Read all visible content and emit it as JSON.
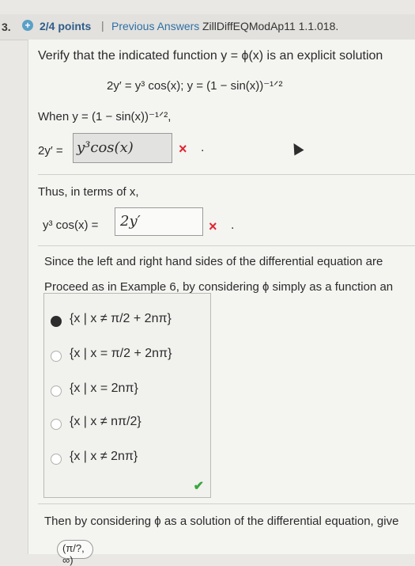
{
  "header": {
    "question_number": "3.",
    "plus_icon": "+",
    "points": "2/4 points",
    "separator": "|",
    "previous_answers": "Previous Answers",
    "problem_code": "ZillDiffEQModAp11 1.1.018."
  },
  "problem": {
    "prompt": "Verify that the indicated function y = ϕ(x) is an explicit solution",
    "equation": "2y′ = y³ cos(x);    y = (1 − sin(x))⁻¹ᐟ²",
    "when_line": "When y = (1 − sin(x))⁻¹ᐟ²,",
    "lhs1_label": "2y′ =",
    "answer1": "y³cos(x)",
    "answer1_status": "×",
    "thus_line": "Thus, in terms of x,",
    "lhs2_label": "y³ cos(x) =",
    "answer2": "2y′",
    "answer2_status": "×",
    "since_line": "Since the left and right hand sides of the differential equation are",
    "proceed_line": "Proceed as in Example 6, by considering ϕ simply as a function an",
    "choices": [
      {
        "text": "{x | x ≠ π/2 + 2nπ}",
        "selected": true
      },
      {
        "text": "{x | x = π/2 + 2nπ}",
        "selected": false
      },
      {
        "text": "{x | x = 2nπ}",
        "selected": false
      },
      {
        "text": "{x | x ≠ nπ/2}",
        "selected": false
      },
      {
        "text": "{x | x ≠ 2nπ}",
        "selected": false
      }
    ],
    "choices_status": "✔",
    "then_line": "Then by considering ϕ as a solution of the differential equation, give",
    "partial_option": "(π/?, ∞)"
  },
  "colors": {
    "error": "#e0242f",
    "correct": "#3aa63e",
    "link": "#2f6fa7"
  }
}
